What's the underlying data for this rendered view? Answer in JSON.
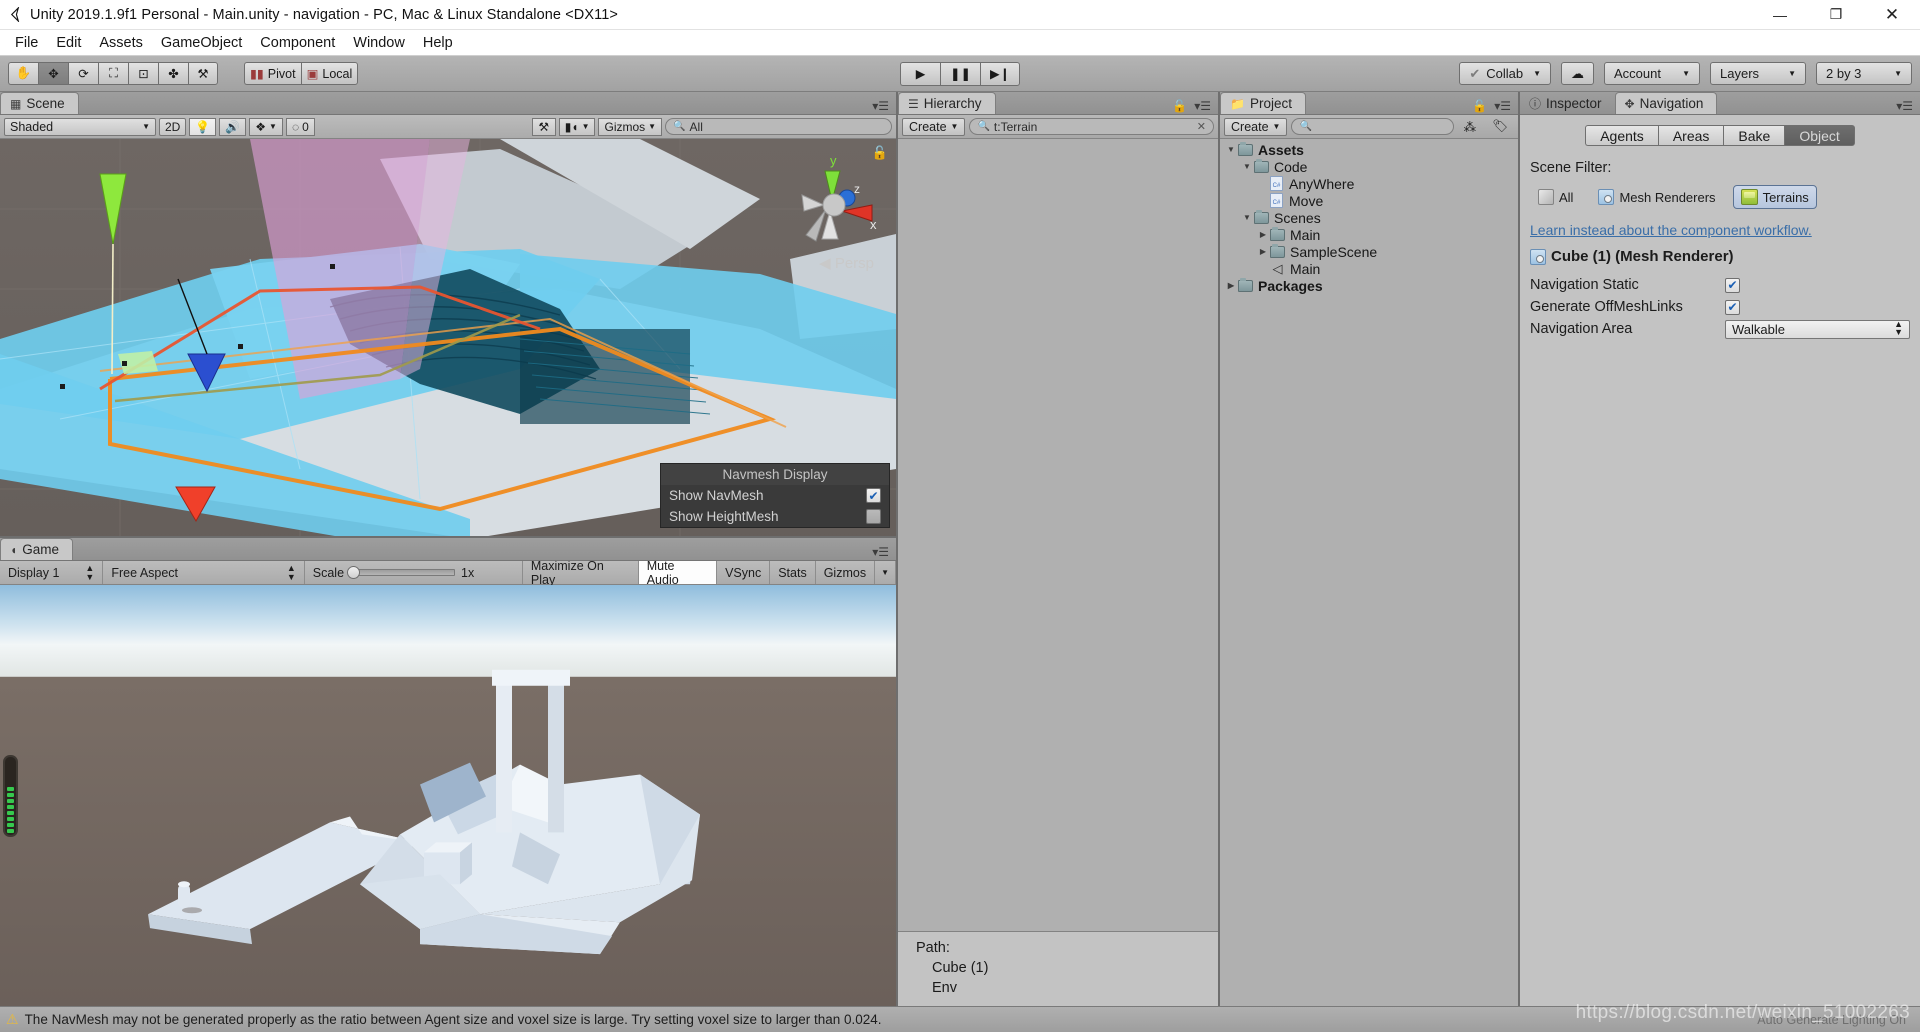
{
  "window": {
    "title": "Unity 2019.1.9f1 Personal - Main.unity - navigation - PC, Mac & Linux Standalone <DX11>",
    "app_icon": "unity-logo-icon",
    "minimize": "—",
    "restore": "❐",
    "close": "✕"
  },
  "menu": {
    "items": [
      "File",
      "Edit",
      "Assets",
      "GameObject",
      "Component",
      "Window",
      "Help"
    ]
  },
  "toolbar": {
    "tools": [
      {
        "name": "hand-tool",
        "glyph": "✋",
        "active": false
      },
      {
        "name": "move-tool",
        "glyph": "✥",
        "active": true
      },
      {
        "name": "rotate-tool",
        "glyph": "⟳",
        "active": false
      },
      {
        "name": "scale-tool",
        "glyph": "⛶",
        "active": false
      },
      {
        "name": "rect-tool",
        "glyph": "⊡",
        "active": false
      },
      {
        "name": "transform-tool",
        "glyph": "✤",
        "active": false
      },
      {
        "name": "custom-tool",
        "glyph": "⚒",
        "active": false
      }
    ],
    "pivot_label": "Pivot",
    "local_label": "Local",
    "play_label": "▶",
    "pause_label": "❚❚",
    "step_label": "▶❙",
    "collab_label": "Collab",
    "cloud_label": "cloud-icon",
    "account_label": "Account",
    "layers_label": "Layers",
    "layout_label": "2 by 3"
  },
  "scene_panel": {
    "tab_label": "Scene",
    "tab_icon": "grid-icon",
    "draw_mode": "Shaded",
    "mode_2d": "2D",
    "lighting_icon": "lightbulb-icon",
    "audio_icon": "speaker-icon",
    "fx_icon": "effects-icon",
    "hidden_count": "0",
    "gizmo_tool_icon": "wrench-icon",
    "camera_icon": "camera-icon",
    "gizmos_label": "Gizmos",
    "search_value": "All",
    "axis_x": "x",
    "axis_y": "y",
    "axis_z": "z",
    "persp_label": "Persp"
  },
  "navmesh_overlay": {
    "title": "Navmesh Display",
    "rows": [
      {
        "label": "Show NavMesh",
        "checked": true
      },
      {
        "label": "Show HeightMesh",
        "checked": false
      }
    ]
  },
  "game_panel": {
    "tab_label": "Game",
    "tab_icon": "gamepad-icon",
    "display": "Display 1",
    "aspect": "Free Aspect",
    "scale_label": "Scale",
    "scale_value": "1x",
    "maximize_on_play": "Maximize On Play",
    "mute_audio": "Mute Audio",
    "vsync": "VSync",
    "stats": "Stats",
    "gizmos": "Gizmos"
  },
  "hierarchy": {
    "tab_label": "Hierarchy",
    "tab_icon": "list-icon",
    "create_label": "Create",
    "search_value": "t:Terrain",
    "items": []
  },
  "project": {
    "tab_label": "Project",
    "tab_icon": "folder-icon",
    "create_label": "Create",
    "search_placeholder": "",
    "tree": [
      {
        "label": "Assets",
        "depth": 0,
        "arrow": "down",
        "icon": "folder",
        "bold": true
      },
      {
        "label": "Code",
        "depth": 1,
        "arrow": "down",
        "icon": "folder",
        "bold": false
      },
      {
        "label": "AnyWhere",
        "depth": 2,
        "arrow": "none",
        "icon": "csharp",
        "bold": false
      },
      {
        "label": "Move",
        "depth": 2,
        "arrow": "none",
        "icon": "csharp",
        "bold": false
      },
      {
        "label": "Scenes",
        "depth": 1,
        "arrow": "down",
        "icon": "folder",
        "bold": false
      },
      {
        "label": "Main",
        "depth": 2,
        "arrow": "right",
        "icon": "folder",
        "bold": false
      },
      {
        "label": "SampleScene",
        "depth": 2,
        "arrow": "right",
        "icon": "folder",
        "bold": false
      },
      {
        "label": "Main",
        "depth": 2,
        "arrow": "none",
        "icon": "unity",
        "bold": false
      },
      {
        "label": "Packages",
        "depth": 0,
        "arrow": "right",
        "icon": "folder",
        "bold": true
      }
    ],
    "path_title": "Path:",
    "path_items": [
      "Cube (1)",
      "Env"
    ]
  },
  "inspector": {
    "inspector_tab": "Inspector",
    "inspector_icon": "info-icon",
    "navigation_tab": "Navigation",
    "navigation_icon": "navigation-icon",
    "segments": [
      {
        "label": "Agents",
        "active": false
      },
      {
        "label": "Areas",
        "active": false
      },
      {
        "label": "Bake",
        "active": false
      },
      {
        "label": "Object",
        "active": true
      }
    ],
    "scene_filter_label": "Scene Filter:",
    "filters": [
      {
        "label": "All",
        "icon": "cube-icon",
        "active": false
      },
      {
        "label": "Mesh Renderers",
        "icon": "mesh-icon",
        "active": false
      },
      {
        "label": "Terrains",
        "icon": "terrain-icon",
        "active": true
      }
    ],
    "learn_link": "Learn instead about the component workflow.",
    "object_title": "Cube (1) (Mesh Renderer)",
    "object_icon": "mesh-icon",
    "properties": [
      {
        "label": "Navigation Static",
        "type": "checkbox",
        "value": true
      },
      {
        "label": "Generate OffMeshLinks",
        "type": "checkbox",
        "value": true
      },
      {
        "label": "Navigation Area",
        "type": "dropdown",
        "value": "Walkable"
      }
    ]
  },
  "statusbar": {
    "warning_icon": "warning-icon",
    "message": "The NavMesh may not be generated properly as the ratio between Agent size and voxel size is large. Try setting voxel size to larger than 0.024.",
    "auto_lighting": "Auto Generate Lighting On"
  },
  "watermark": "https://blog.csdn.net/weixin_51002263",
  "colors": {
    "navmesh_cyan": "#6fcdee",
    "selection_orange": "#f08a1e",
    "filter_magenta": "#dfa0d8",
    "ground_brown": "#6a635f",
    "accent_blue": "#3a6ea8",
    "health_green": "#36c94e"
  }
}
